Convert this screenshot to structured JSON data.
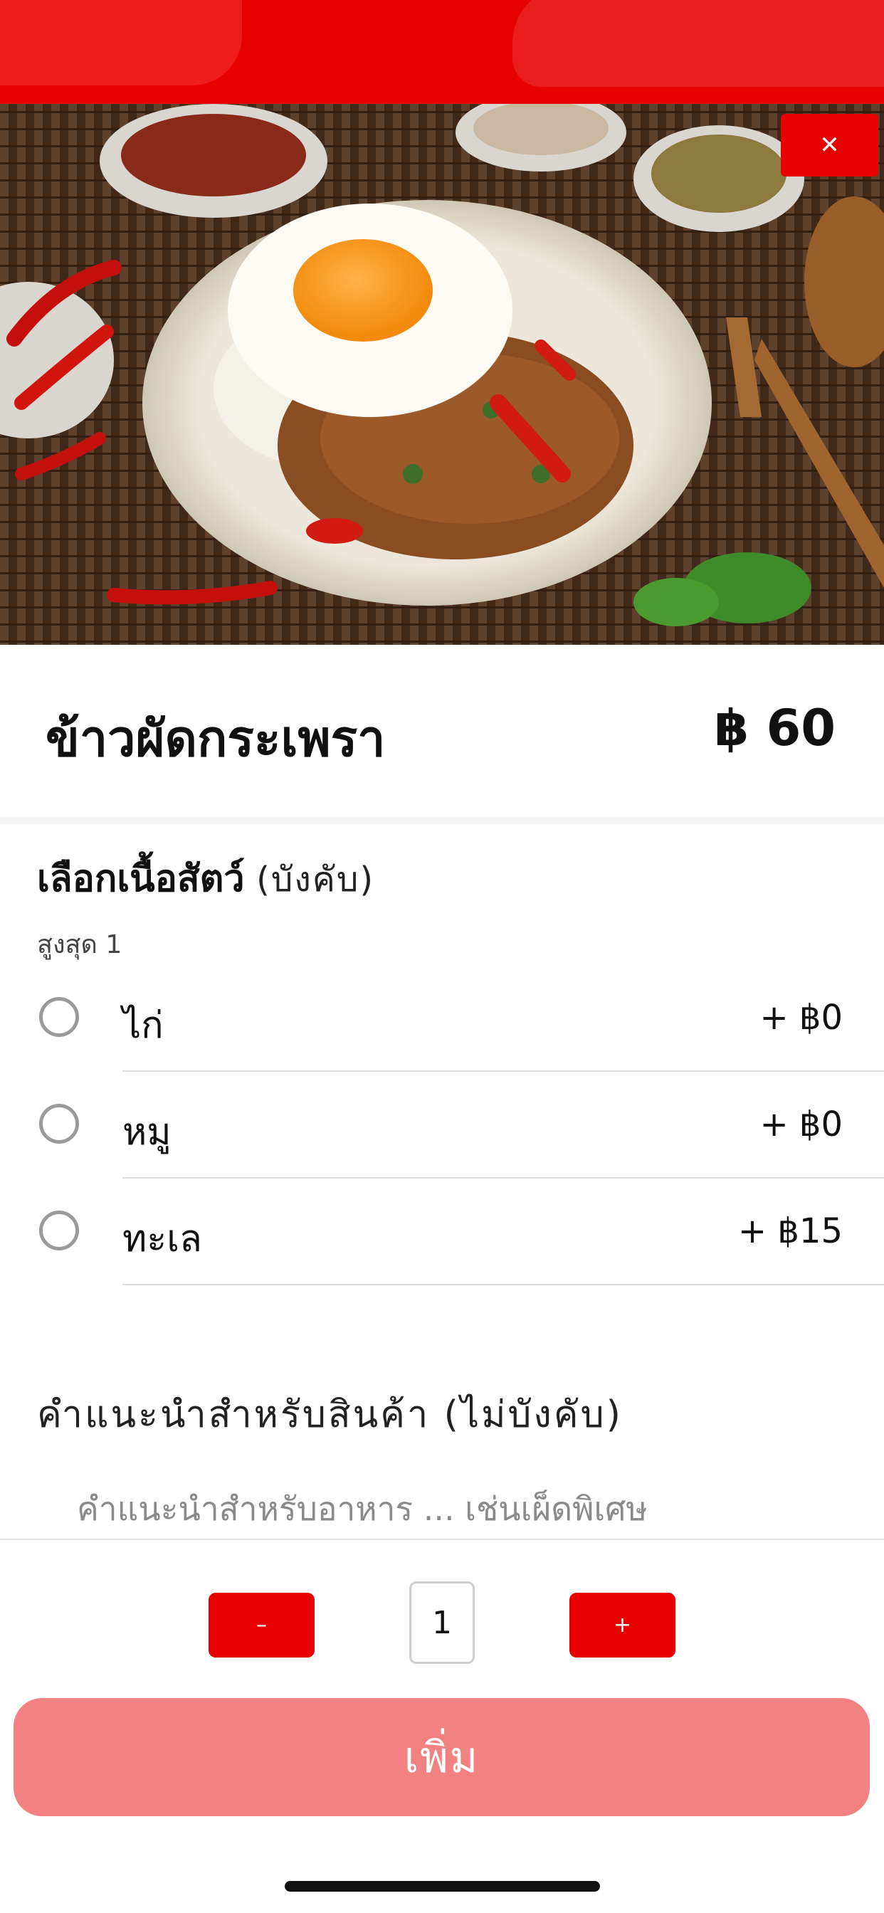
{
  "header": {
    "brand_color": "#e60000"
  },
  "close_button": {
    "label": "✕"
  },
  "item": {
    "name": "ข้าวผัดกระเพรา",
    "price": "฿ 60"
  },
  "meat_section": {
    "title": "เลือกเนื้อสัตว์",
    "required_label": "(บังคับ)",
    "max_label": "สูงสุด 1",
    "options": [
      {
        "label": "ไก่",
        "price": "+ ฿0"
      },
      {
        "label": "หมู",
        "price": "+ ฿0"
      },
      {
        "label": "ทะเล",
        "price": "+ ฿15"
      }
    ]
  },
  "note": {
    "title": "คำแนะนำสำหรับสินค้า (ไม่บังคับ)",
    "placeholder": "คำแนะนำสำหรับอาหาร ... เช่นเผ็ดพิเศษ",
    "value": ""
  },
  "quantity": {
    "minus_label": "–",
    "plus_label": "+",
    "value": "1"
  },
  "add_button": {
    "label": "เพิ่ม",
    "color": "#f28282"
  }
}
